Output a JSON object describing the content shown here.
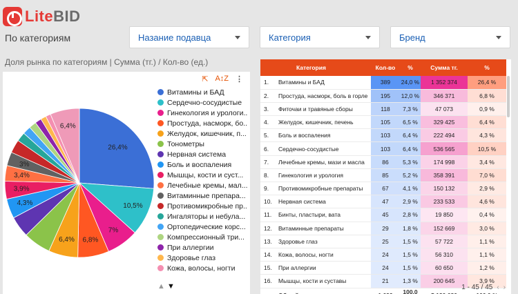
{
  "brand": {
    "part1": "Lite",
    "part2": "BID"
  },
  "page_title": "По категориям",
  "filters": [
    {
      "label": "Назание подавца"
    },
    {
      "label": "Категория"
    },
    {
      "label": "Бренд"
    }
  ],
  "pie": {
    "title": "Доля рынка по категориям | Сумма (тг.) / Кол-во (ед.)",
    "tools": {
      "export_icon": "export-icon",
      "sort_icon": "sort-az-icon"
    },
    "pager": {
      "up": "▲",
      "down": "▼"
    }
  },
  "chart_data": {
    "type": "pie",
    "slices": [
      {
        "label": "Витамины и БАД",
        "value": 26.4,
        "color": "#3b6fd6",
        "shown": "26,4%"
      },
      {
        "label": "Сердечно-сосудистые",
        "value": 10.5,
        "color": "#2ec0c9",
        "shown": "10,5%"
      },
      {
        "label": "Гинекология и урологи...",
        "value": 7.0,
        "color": "#e91e8c",
        "shown": "7%"
      },
      {
        "label": "Простуда, насморк, бо...",
        "value": 6.8,
        "color": "#ff5722",
        "shown": "6,8%"
      },
      {
        "label": "Желудок, кишечник, п...",
        "value": 6.4,
        "color": "#f7a21b",
        "shown": "6,4%"
      },
      {
        "label": "Тонометры",
        "value": 6.0,
        "color": "#8bc34a",
        "shown": ""
      },
      {
        "label": "Нервная система",
        "value": 4.6,
        "color": "#5e35b1",
        "shown": ""
      },
      {
        "label": "Боль и воспаления",
        "value": 4.3,
        "color": "#2196f3",
        "shown": "4,3%"
      },
      {
        "label": "Мышцы, кости и суст...",
        "value": 3.9,
        "color": "#e91e63",
        "shown": "3,9%"
      },
      {
        "label": "Лечебные кремы, мал...",
        "value": 3.4,
        "color": "#ff7043",
        "shown": "3,4%"
      },
      {
        "label": "Витаминные препара...",
        "value": 3.0,
        "color": "#616161",
        "shown": "3%"
      },
      {
        "label": "Противомикробные пр...",
        "value": 2.9,
        "color": "#c62828",
        "shown": ""
      },
      {
        "label": "Ингаляторы и небула...",
        "value": 2.0,
        "color": "#26a69a",
        "shown": ""
      },
      {
        "label": "Ортопедические корс...",
        "value": 1.8,
        "color": "#42a5f5",
        "shown": ""
      },
      {
        "label": "Компрессионный три...",
        "value": 1.6,
        "color": "#aed581",
        "shown": ""
      },
      {
        "label": "При аллергии",
        "value": 1.4,
        "color": "#8e24aa",
        "shown": ""
      },
      {
        "label": "Здоровье глаз",
        "value": 1.2,
        "color": "#ffb74d",
        "shown": ""
      },
      {
        "label": "Кожа, волосы, ногти",
        "value": 1.1,
        "color": "#f48fb1",
        "shown": ""
      },
      {
        "label": "",
        "value": 6.4,
        "color": "#ef9ab8",
        "shown": "6,4%"
      }
    ]
  },
  "table": {
    "headers": {
      "cat": "Категория",
      "qty": "Кол-во",
      "pct1": "%",
      "sum": "Сумма тг.",
      "pct2": "%"
    },
    "rows": [
      {
        "n": "1.",
        "cat": "Витамины и БАД",
        "qty": "389",
        "pct1": "24,0 %",
        "sum": "1 352 374",
        "pct2": "26,4 %"
      },
      {
        "n": "2.",
        "cat": "Простуда, насморк, боль в горле",
        "qty": "195",
        "pct1": "12,0 %",
        "sum": "346 371",
        "pct2": "6,8 %"
      },
      {
        "n": "3.",
        "cat": "Фиточаи и травяные сборы",
        "qty": "118",
        "pct1": "7,3 %",
        "sum": "47 073",
        "pct2": "0,9 %"
      },
      {
        "n": "4.",
        "cat": "Желудок, кишечник, печень",
        "qty": "105",
        "pct1": "6,5 %",
        "sum": "329 425",
        "pct2": "6,4 %"
      },
      {
        "n": "5.",
        "cat": "Боль и воспаления",
        "qty": "103",
        "pct1": "6,4 %",
        "sum": "222 494",
        "pct2": "4,3 %"
      },
      {
        "n": "6.",
        "cat": "Сердечно-сосудистые",
        "qty": "103",
        "pct1": "6,4 %",
        "sum": "536 565",
        "pct2": "10,5 %"
      },
      {
        "n": "7.",
        "cat": "Лечебные кремы, мази и масла",
        "qty": "86",
        "pct1": "5,3 %",
        "sum": "174 998",
        "pct2": "3,4 %"
      },
      {
        "n": "8.",
        "cat": "Гинекология и урология",
        "qty": "85",
        "pct1": "5,2 %",
        "sum": "358 391",
        "pct2": "7,0 %"
      },
      {
        "n": "9.",
        "cat": "Противомикробные препараты",
        "qty": "67",
        "pct1": "4,1 %",
        "sum": "150 132",
        "pct2": "2,9 %"
      },
      {
        "n": "10.",
        "cat": "Нервная система",
        "qty": "47",
        "pct1": "2,9 %",
        "sum": "233 533",
        "pct2": "4,6 %"
      },
      {
        "n": "11.",
        "cat": "Бинты, пластыри, вата",
        "qty": "45",
        "pct1": "2,8 %",
        "sum": "19 850",
        "pct2": "0,4 %"
      },
      {
        "n": "12.",
        "cat": "Витаминные препараты",
        "qty": "29",
        "pct1": "1,8 %",
        "sum": "152 669",
        "pct2": "3,0 %"
      },
      {
        "n": "13.",
        "cat": "Здоровье глаз",
        "qty": "25",
        "pct1": "1,5 %",
        "sum": "57 722",
        "pct2": "1,1 %"
      },
      {
        "n": "14.",
        "cat": "Кожа, волосы, ногти",
        "qty": "24",
        "pct1": "1,5 %",
        "sum": "56 310",
        "pct2": "1,1 %"
      },
      {
        "n": "15.",
        "cat": "При аллергии",
        "qty": "24",
        "pct1": "1,5 %",
        "sum": "60 650",
        "pct2": "1,2 %"
      },
      {
        "n": "16.",
        "cat": "Мышцы, кости и суставы",
        "qty": "21",
        "pct1": "1,3 %",
        "sum": "200 645",
        "pct2": "3,9 %"
      }
    ],
    "total": {
      "label": "Общий итог",
      "qty": "1 622",
      "pct1": "100,0 %",
      "sum": "5 130 686",
      "pct2": "100,0 %"
    },
    "pager": {
      "range": "1 - 45 / 45",
      "prev": "‹",
      "next": "›"
    }
  }
}
